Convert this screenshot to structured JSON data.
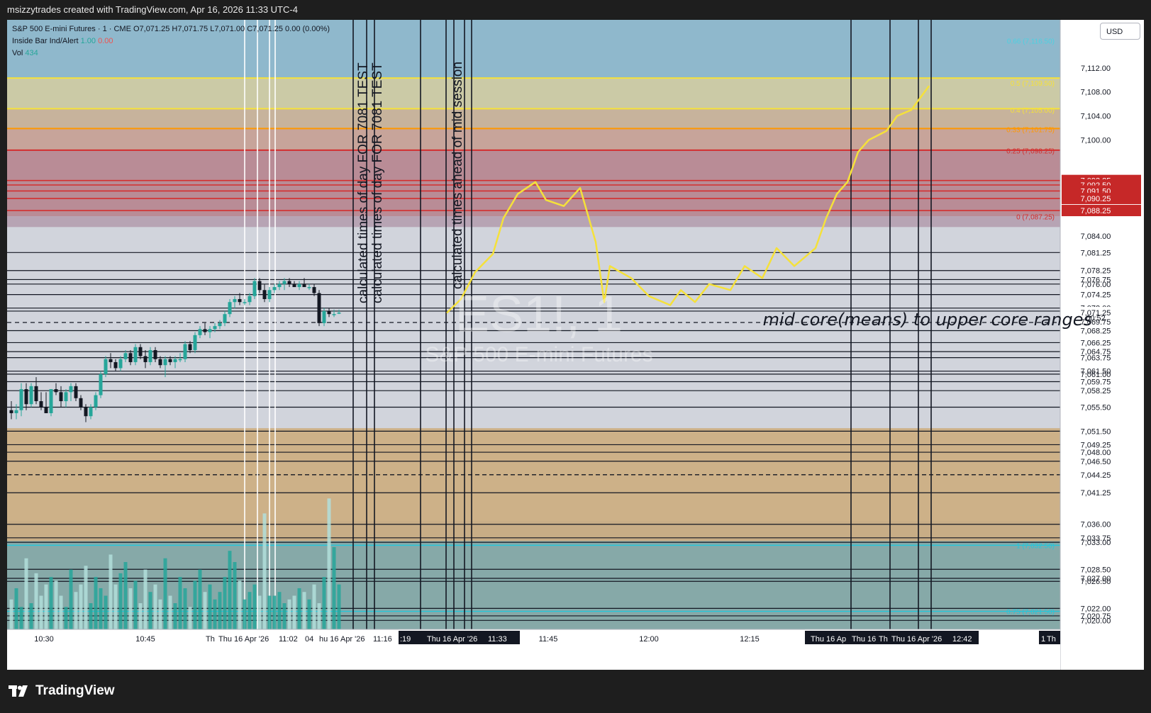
{
  "header": {
    "title": "msizzytrades created with TradingView.com, Apr 16, 2026 11:33 UTC-4"
  },
  "legend": {
    "symbol_line": "S&P 500 E-mini Futures · 1 · CME  O7,071.25  H7,071.75  L7,071.00  C7,071.25  0.00 (0.00%)",
    "inside_bar_label": "Inside Bar Ind/Alert",
    "inside_bar_value_1": "1.00",
    "inside_bar_value_2": "0.00",
    "vol_label": "Vol",
    "vol_value": "434"
  },
  "currency": "USD",
  "watermark": {
    "ticker": "ES1!, 1",
    "name": "S&P 500 E-mini Futures"
  },
  "annotations": {
    "vertical_1": "calculated times of day FOR 7081 TEST",
    "vertical_2": "calculated times of day FOR 7081 TEST",
    "vertical_3": "calculated times ahead of mid session",
    "horizontal": "mid core(means) to upper core ranges"
  },
  "price_axis": {
    "labels": [
      {
        "text": "7,112.00",
        "price": 7112.0
      },
      {
        "text": "7,108.00",
        "price": 7108.0
      },
      {
        "text": "7,104.00",
        "price": 7104.0
      },
      {
        "text": "7,100.00",
        "price": 7100.0
      },
      {
        "text": "7,084.00",
        "price": 7084.0
      },
      {
        "text": "7,081.25",
        "price": 7081.25
      },
      {
        "text": "7,078.25",
        "price": 7078.25
      },
      {
        "text": "7,076.75",
        "price": 7076.75
      },
      {
        "text": "7,076.00",
        "price": 7076.0
      },
      {
        "text": "7,074.25",
        "price": 7074.25
      },
      {
        "text": "7,072.00",
        "price": 7072.0
      },
      {
        "text": "7,071.50",
        "price": 7071.5
      },
      {
        "text": "7,071.25",
        "price": 7071.25
      },
      {
        "text": "00:52",
        "price": 7070.4
      },
      {
        "text": "7,069.75",
        "price": 7069.75
      },
      {
        "text": "7,068.25",
        "price": 7068.25
      },
      {
        "text": "7,066.25",
        "price": 7066.25
      },
      {
        "text": "7,064.75",
        "price": 7064.75
      },
      {
        "text": "7,063.75",
        "price": 7063.75
      },
      {
        "text": "7,061.50",
        "price": 7061.5
      },
      {
        "text": "7,061.00",
        "price": 7061.0
      },
      {
        "text": "7,059.75",
        "price": 7059.75
      },
      {
        "text": "7,058.25",
        "price": 7058.25
      },
      {
        "text": "7,055.50",
        "price": 7055.5
      },
      {
        "text": "7,051.50",
        "price": 7051.5
      },
      {
        "text": "7,049.25",
        "price": 7049.25
      },
      {
        "text": "7,048.00",
        "price": 7048.0
      },
      {
        "text": "7,046.50",
        "price": 7046.5
      },
      {
        "text": "7,044.25",
        "price": 7044.25
      },
      {
        "text": "7,041.25",
        "price": 7041.25
      },
      {
        "text": "7,036.00",
        "price": 7036.0
      },
      {
        "text": "7,033.75",
        "price": 7033.75
      },
      {
        "text": "7,033.00",
        "price": 7033.0
      },
      {
        "text": "7,028.50",
        "price": 7028.5
      },
      {
        "text": "7,027.00",
        "price": 7027.0
      },
      {
        "text": "7,026.50",
        "price": 7026.5
      },
      {
        "text": "7,022.00",
        "price": 7022.0
      },
      {
        "text": "7,020.75",
        "price": 7020.75
      },
      {
        "text": "7,020.00",
        "price": 7020.0
      }
    ],
    "red_labels": [
      {
        "text": "7,093.25",
        "price": 7093.25
      },
      {
        "text": "7,092.50",
        "price": 7092.5
      },
      {
        "text": "7,091.50",
        "price": 7091.5
      },
      {
        "text": "7,090.25",
        "price": 7090.25
      },
      {
        "text": "7,088.25",
        "price": 7088.25
      }
    ]
  },
  "fib_labels": [
    {
      "text": "0.66 (7,116.50)",
      "color": "#4dd0e1",
      "price": 7116.5
    },
    {
      "text": "0.5 (7,109.50)",
      "color": "#f5e13a",
      "price": 7109.5
    },
    {
      "text": "0.4 (7,105.00)",
      "color": "#f5e13a",
      "price": 7105.0
    },
    {
      "text": "0.33 (7,101.75)",
      "color": "#ff9800",
      "price": 7101.75
    },
    {
      "text": "0.25 (7,098.25)",
      "color": "#d32f2f",
      "price": 7098.25
    },
    {
      "text": "0 (7,087.25)",
      "color": "#d32f2f",
      "price": 7087.25
    },
    {
      "text": "1 (7,032.50)",
      "color": "#26c6da",
      "price": 7032.5
    },
    {
      "text": "0.75 (7,021.50)",
      "color": "#26c6da",
      "price": 7021.5
    }
  ],
  "time_axis": {
    "ticks": [
      "10:30",
      "10:45",
      "12:00",
      "12:15",
      "11:45"
    ],
    "highlight_1": [
      "Th",
      "Thu 16 Apr '26",
      "11:02",
      "04",
      "hu 16 Apr '26",
      "11:16"
    ],
    "highlight_2": [
      ":19",
      "Thu 16 Apr '26",
      "11:33"
    ],
    "highlight_3": [
      "Thu 16 Ap",
      "Thu 16",
      "Th",
      "Thu 16 Apr '26",
      "12:42"
    ],
    "highlight_4": [
      "1",
      "Th"
    ]
  },
  "colors": {
    "up": "#26a69a",
    "down": "#131722",
    "projection": "#f5e13a",
    "red_zone": "#d32f2f",
    "brand": "#ffffff"
  },
  "chart_data": {
    "type": "candlestick",
    "timeframe": "1",
    "ylim": [
      7018.5,
      7120.0
    ],
    "candles": [
      {
        "o": 7055.0,
        "h": 7056.5,
        "l": 7053.5,
        "c": 7054.5
      },
      {
        "o": 7054.5,
        "h": 7056.0,
        "l": 7053.5,
        "c": 7055.0
      },
      {
        "o": 7055.0,
        "h": 7059.5,
        "l": 7054.0,
        "c": 7058.5
      },
      {
        "o": 7058.5,
        "h": 7059.5,
        "l": 7055.0,
        "c": 7056.0
      },
      {
        "o": 7056.0,
        "h": 7059.5,
        "l": 7055.5,
        "c": 7059.0
      },
      {
        "o": 7059.0,
        "h": 7060.5,
        "l": 7056.0,
        "c": 7056.5
      },
      {
        "o": 7056.5,
        "h": 7058.0,
        "l": 7055.0,
        "c": 7055.5
      },
      {
        "o": 7055.5,
        "h": 7058.0,
        "l": 7054.5,
        "c": 7054.5
      },
      {
        "o": 7054.5,
        "h": 7058.5,
        "l": 7054.0,
        "c": 7058.5
      },
      {
        "o": 7058.5,
        "h": 7059.5,
        "l": 7057.5,
        "c": 7058.0
      },
      {
        "o": 7058.0,
        "h": 7059.0,
        "l": 7055.5,
        "c": 7056.5
      },
      {
        "o": 7056.5,
        "h": 7058.5,
        "l": 7055.5,
        "c": 7058.0
      },
      {
        "o": 7058.0,
        "h": 7059.5,
        "l": 7056.5,
        "c": 7059.0
      },
      {
        "o": 7059.0,
        "h": 7059.5,
        "l": 7056.5,
        "c": 7057.0
      },
      {
        "o": 7057.0,
        "h": 7057.5,
        "l": 7055.0,
        "c": 7055.5
      },
      {
        "o": 7055.5,
        "h": 7056.0,
        "l": 7053.0,
        "c": 7054.0
      },
      {
        "o": 7054.0,
        "h": 7056.0,
        "l": 7053.5,
        "c": 7055.5
      },
      {
        "o": 7055.5,
        "h": 7058.0,
        "l": 7055.0,
        "c": 7057.5
      },
      {
        "o": 7057.5,
        "h": 7061.5,
        "l": 7057.0,
        "c": 7061.0
      },
      {
        "o": 7061.0,
        "h": 7064.0,
        "l": 7060.5,
        "c": 7063.5
      },
      {
        "o": 7063.5,
        "h": 7064.5,
        "l": 7062.0,
        "c": 7063.0
      },
      {
        "o": 7063.0,
        "h": 7063.5,
        "l": 7061.5,
        "c": 7062.0
      },
      {
        "o": 7062.0,
        "h": 7064.0,
        "l": 7061.5,
        "c": 7063.5
      },
      {
        "o": 7063.5,
        "h": 7065.0,
        "l": 7063.0,
        "c": 7064.5
      },
      {
        "o": 7064.5,
        "h": 7065.0,
        "l": 7062.5,
        "c": 7063.0
      },
      {
        "o": 7063.0,
        "h": 7066.0,
        "l": 7062.5,
        "c": 7065.5
      },
      {
        "o": 7065.5,
        "h": 7066.0,
        "l": 7063.5,
        "c": 7064.0
      },
      {
        "o": 7064.0,
        "h": 7065.0,
        "l": 7062.0,
        "c": 7063.0
      },
      {
        "o": 7063.0,
        "h": 7065.5,
        "l": 7062.5,
        "c": 7065.0
      },
      {
        "o": 7065.0,
        "h": 7065.5,
        "l": 7063.0,
        "c": 7063.5
      },
      {
        "o": 7063.5,
        "h": 7064.0,
        "l": 7062.0,
        "c": 7062.5
      },
      {
        "o": 7062.5,
        "h": 7064.0,
        "l": 7060.5,
        "c": 7063.5
      },
      {
        "o": 7063.5,
        "h": 7064.0,
        "l": 7062.5,
        "c": 7063.0
      },
      {
        "o": 7063.0,
        "h": 7064.0,
        "l": 7062.0,
        "c": 7063.5
      },
      {
        "o": 7063.5,
        "h": 7064.5,
        "l": 7063.0,
        "c": 7063.5
      },
      {
        "o": 7063.5,
        "h": 7066.5,
        "l": 7063.0,
        "c": 7066.0
      },
      {
        "o": 7066.0,
        "h": 7066.5,
        "l": 7064.5,
        "c": 7065.0
      },
      {
        "o": 7065.0,
        "h": 7068.0,
        "l": 7064.5,
        "c": 7067.5
      },
      {
        "o": 7067.5,
        "h": 7069.0,
        "l": 7067.0,
        "c": 7068.5
      },
      {
        "o": 7068.5,
        "h": 7069.5,
        "l": 7067.5,
        "c": 7068.0
      },
      {
        "o": 7068.0,
        "h": 7069.0,
        "l": 7067.0,
        "c": 7068.5
      },
      {
        "o": 7068.5,
        "h": 7069.5,
        "l": 7068.0,
        "c": 7069.0
      },
      {
        "o": 7069.0,
        "h": 7070.0,
        "l": 7068.5,
        "c": 7069.5
      },
      {
        "o": 7069.5,
        "h": 7071.5,
        "l": 7069.0,
        "c": 7071.0
      },
      {
        "o": 7071.0,
        "h": 7073.5,
        "l": 7070.5,
        "c": 7073.0
      },
      {
        "o": 7073.0,
        "h": 7074.0,
        "l": 7072.0,
        "c": 7073.5
      },
      {
        "o": 7073.5,
        "h": 7074.5,
        "l": 7072.5,
        "c": 7073.0
      },
      {
        "o": 7073.0,
        "h": 7073.5,
        "l": 7072.5,
        "c": 7073.0
      },
      {
        "o": 7073.0,
        "h": 7074.5,
        "l": 7072.5,
        "c": 7074.0
      },
      {
        "o": 7074.0,
        "h": 7077.0,
        "l": 7073.5,
        "c": 7076.5
      },
      {
        "o": 7076.5,
        "h": 7077.0,
        "l": 7074.5,
        "c": 7075.0
      },
      {
        "o": 7075.0,
        "h": 7076.0,
        "l": 7073.0,
        "c": 7073.5
      },
      {
        "o": 7073.5,
        "h": 7075.5,
        "l": 7073.0,
        "c": 7075.0
      },
      {
        "o": 7075.0,
        "h": 7076.0,
        "l": 7074.5,
        "c": 7075.5
      },
      {
        "o": 7075.5,
        "h": 7076.5,
        "l": 7075.0,
        "c": 7076.0
      },
      {
        "o": 7076.0,
        "h": 7077.0,
        "l": 7075.0,
        "c": 7076.5
      },
      {
        "o": 7076.5,
        "h": 7077.0,
        "l": 7075.5,
        "c": 7076.0
      },
      {
        "o": 7076.0,
        "h": 7076.5,
        "l": 7075.5,
        "c": 7075.5
      },
      {
        "o": 7075.5,
        "h": 7076.5,
        "l": 7075.0,
        "c": 7076.0
      },
      {
        "o": 7076.0,
        "h": 7077.0,
        "l": 7075.5,
        "c": 7075.5
      },
      {
        "o": 7075.5,
        "h": 7076.0,
        "l": 7075.0,
        "c": 7075.5
      },
      {
        "o": 7075.5,
        "h": 7076.0,
        "l": 7074.0,
        "c": 7074.5
      },
      {
        "o": 7074.5,
        "h": 7075.0,
        "l": 7069.0,
        "c": 7069.5
      },
      {
        "o": 7069.5,
        "h": 7072.0,
        "l": 7069.0,
        "c": 7071.5
      },
      {
        "o": 7071.5,
        "h": 7072.0,
        "l": 7070.5,
        "c": 7071.0
      },
      {
        "o": 7071.0,
        "h": 7071.75,
        "l": 7070.5,
        "c": 7071.0
      },
      {
        "o": 7071.25,
        "h": 7071.75,
        "l": 7071.0,
        "c": 7071.25
      }
    ],
    "volumes": [
      8,
      11,
      6,
      19,
      7,
      15,
      9,
      12,
      14,
      13,
      9,
      6,
      16,
      10,
      12,
      17,
      7,
      14,
      11,
      9,
      20,
      12,
      15,
      18,
      11,
      13,
      7,
      16,
      10,
      12,
      8,
      19,
      9,
      7,
      14,
      11,
      6,
      13,
      16,
      10,
      12,
      8,
      10,
      14,
      21,
      18,
      13,
      8,
      10,
      12,
      9,
      31,
      9,
      9,
      10,
      7,
      8,
      9,
      11,
      10,
      8,
      12,
      7,
      14,
      35,
      22,
      12
    ]
  }
}
